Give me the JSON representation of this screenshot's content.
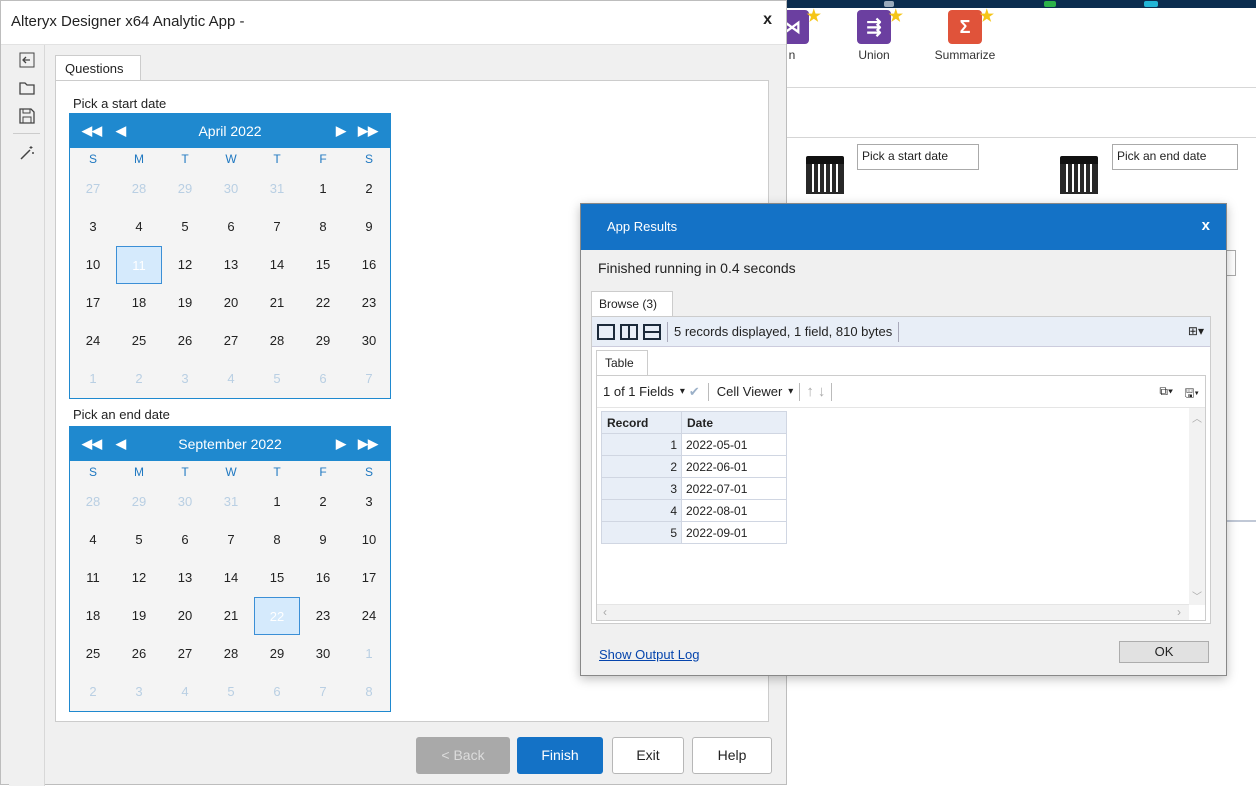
{
  "app": {
    "title": "Alteryx Designer x64 Analytic App -",
    "close": "x",
    "tab": "Questions",
    "start_label": "Pick a start date",
    "end_label": "Pick an end date",
    "buttons": {
      "back": "< Back",
      "finish": "Finish",
      "exit": "Exit",
      "help": "Help"
    }
  },
  "dow": [
    "S",
    "M",
    "T",
    "W",
    "T",
    "F",
    "S"
  ],
  "cal_start": {
    "month": "April 2022",
    "nav": {
      "first": "◀◀",
      "prev": "◀",
      "next": "▶",
      "last": "▶▶"
    },
    "weeks": [
      [
        "27",
        "28",
        "29",
        "30",
        "31",
        "1",
        "2"
      ],
      [
        "3",
        "4",
        "5",
        "6",
        "7",
        "8",
        "9"
      ],
      [
        "10",
        "11",
        "12",
        "13",
        "14",
        "15",
        "16"
      ],
      [
        "17",
        "18",
        "19",
        "20",
        "21",
        "22",
        "23"
      ],
      [
        "24",
        "25",
        "26",
        "27",
        "28",
        "29",
        "30"
      ],
      [
        "1",
        "2",
        "3",
        "4",
        "5",
        "6",
        "7"
      ]
    ],
    "other": [
      [
        0,
        0
      ],
      [
        0,
        1
      ],
      [
        0,
        2
      ],
      [
        0,
        3
      ],
      [
        0,
        4
      ],
      [
        5,
        0
      ],
      [
        5,
        1
      ],
      [
        5,
        2
      ],
      [
        5,
        3
      ],
      [
        5,
        4
      ],
      [
        5,
        5
      ],
      [
        5,
        6
      ]
    ],
    "selected": [
      2,
      1
    ]
  },
  "cal_end": {
    "month": "September 2022",
    "nav": {
      "first": "◀◀",
      "prev": "◀",
      "next": "▶",
      "last": "▶▶"
    },
    "weeks": [
      [
        "28",
        "29",
        "30",
        "31",
        "1",
        "2",
        "3"
      ],
      [
        "4",
        "5",
        "6",
        "7",
        "8",
        "9",
        "10"
      ],
      [
        "11",
        "12",
        "13",
        "14",
        "15",
        "16",
        "17"
      ],
      [
        "18",
        "19",
        "20",
        "21",
        "22",
        "23",
        "24"
      ],
      [
        "25",
        "26",
        "27",
        "28",
        "29",
        "30",
        "1"
      ],
      [
        "2",
        "3",
        "4",
        "5",
        "6",
        "7",
        "8"
      ]
    ],
    "other": [
      [
        0,
        0
      ],
      [
        0,
        1
      ],
      [
        0,
        2
      ],
      [
        0,
        3
      ],
      [
        4,
        6
      ],
      [
        5,
        0
      ],
      [
        5,
        1
      ],
      [
        5,
        2
      ],
      [
        5,
        3
      ],
      [
        5,
        4
      ],
      [
        5,
        5
      ],
      [
        5,
        6
      ]
    ],
    "selected": [
      3,
      4
    ]
  },
  "background": {
    "tools": [
      {
        "label": "n",
        "color": "#6b3fa0"
      },
      {
        "label": "Union",
        "color": "#6b3fa0"
      },
      {
        "label": "Summarize",
        "color": "#e0533a"
      }
    ],
    "start_box": "Pick a start date",
    "end_box": "Pick an end date"
  },
  "results": {
    "title": "App Results",
    "close": "x",
    "status": "Finished running in 0.4 seconds",
    "browse_tab": "Browse (3)",
    "summary": "5 records displayed, 1 field, 810 bytes",
    "table_tab": "Table",
    "fields": "1 of 1 Fields",
    "cell_viewer": "Cell Viewer",
    "columns": [
      "Record",
      "Date"
    ],
    "rows": [
      [
        "1",
        "2022-05-01"
      ],
      [
        "2",
        "2022-06-01"
      ],
      [
        "3",
        "2022-07-01"
      ],
      [
        "4",
        "2022-08-01"
      ],
      [
        "5",
        "2022-09-01"
      ]
    ],
    "show_log": "Show Output Log",
    "ok": "OK"
  }
}
